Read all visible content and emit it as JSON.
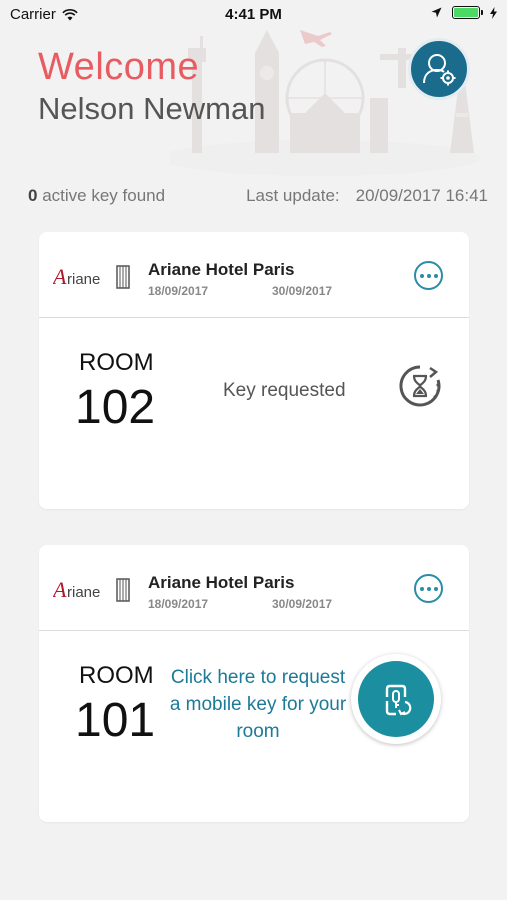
{
  "status_bar": {
    "carrier": "Carrier",
    "time": "4:41 PM"
  },
  "header": {
    "welcome": "Welcome",
    "user_name": "Nelson Newman"
  },
  "summary": {
    "active_count": "0",
    "active_label": "active key found",
    "last_update_label": "Last update:",
    "last_update_value": "20/09/2017 16:41"
  },
  "cards": [
    {
      "hotel_name": "Ariane Hotel Paris",
      "date_from": "18/09/2017",
      "date_to": "30/09/2017",
      "room_label": "ROOM",
      "room_number": "102",
      "status": "Key requested"
    },
    {
      "hotel_name": "Ariane Hotel Paris",
      "date_from": "18/09/2017",
      "date_to": "30/09/2017",
      "room_label": "ROOM",
      "room_number": "101",
      "request_text": "Click here to request a mobile key for your room"
    }
  ],
  "colors": {
    "accent": "#1b8fa0",
    "brand_red": "#e85c61",
    "link": "#1d7a97"
  },
  "icons": [
    "wifi-icon",
    "location-arrow-icon",
    "battery-icon",
    "profile-settings-icon",
    "more-icon",
    "hourglass-icon",
    "mobile-key-icon"
  ]
}
